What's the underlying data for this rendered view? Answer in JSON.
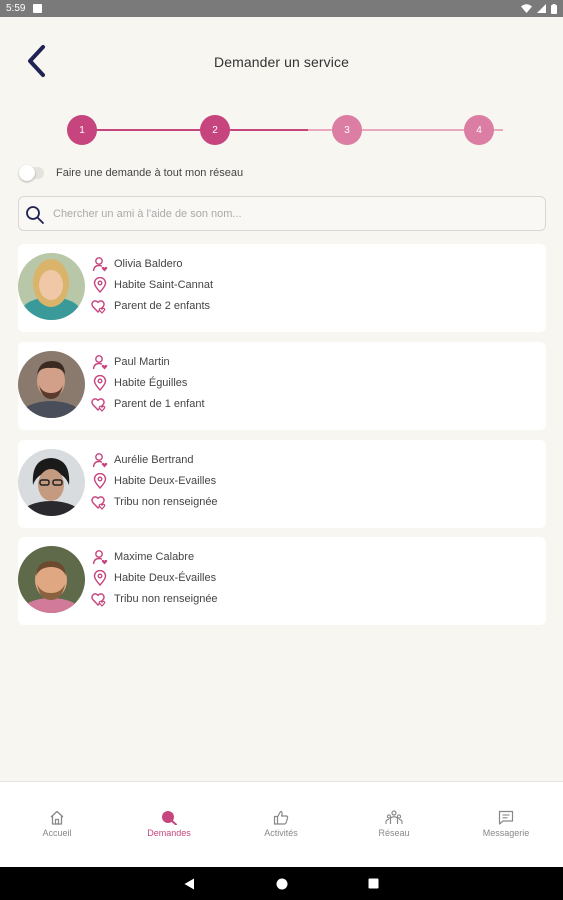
{
  "status_bar": {
    "time": "5:59"
  },
  "header": {
    "title": "Demander un service"
  },
  "stepper": {
    "steps": [
      "1",
      "2",
      "3",
      "4"
    ],
    "current_step": 2
  },
  "network_toggle": {
    "label": "Faire une demande à tout mon réseau",
    "checked": false
  },
  "search": {
    "placeholder": "Chercher un ami à l'aide de son nom..."
  },
  "friends": [
    {
      "name": "Olivia Baldero",
      "location": "Habite Saint-Cannat",
      "family": "Parent de 2 enfants"
    },
    {
      "name": "Paul Martin",
      "location": "Habite Éguilles",
      "family": "Parent de 1 enfant"
    },
    {
      "name": "Aurélie Bertrand",
      "location": "Habite Deux-Evailles",
      "family": "Tribu non renseignée"
    },
    {
      "name": "Maxime Calabre",
      "location": "Habite Deux-Évailles",
      "family": "Tribu non renseignée"
    }
  ],
  "tabs": [
    {
      "label": "Accueil",
      "icon": "home-icon"
    },
    {
      "label": "Demandes",
      "icon": "search-icon",
      "active": true
    },
    {
      "label": "Activités",
      "icon": "thumbs-up-icon"
    },
    {
      "label": "Réseau",
      "icon": "people-icon"
    },
    {
      "label": "Messagerie",
      "icon": "message-icon"
    }
  ],
  "colors": {
    "accent": "#c7457e",
    "accent_light": "#dc7da4",
    "navy": "#1f2252",
    "background": "#f8f6f1"
  }
}
